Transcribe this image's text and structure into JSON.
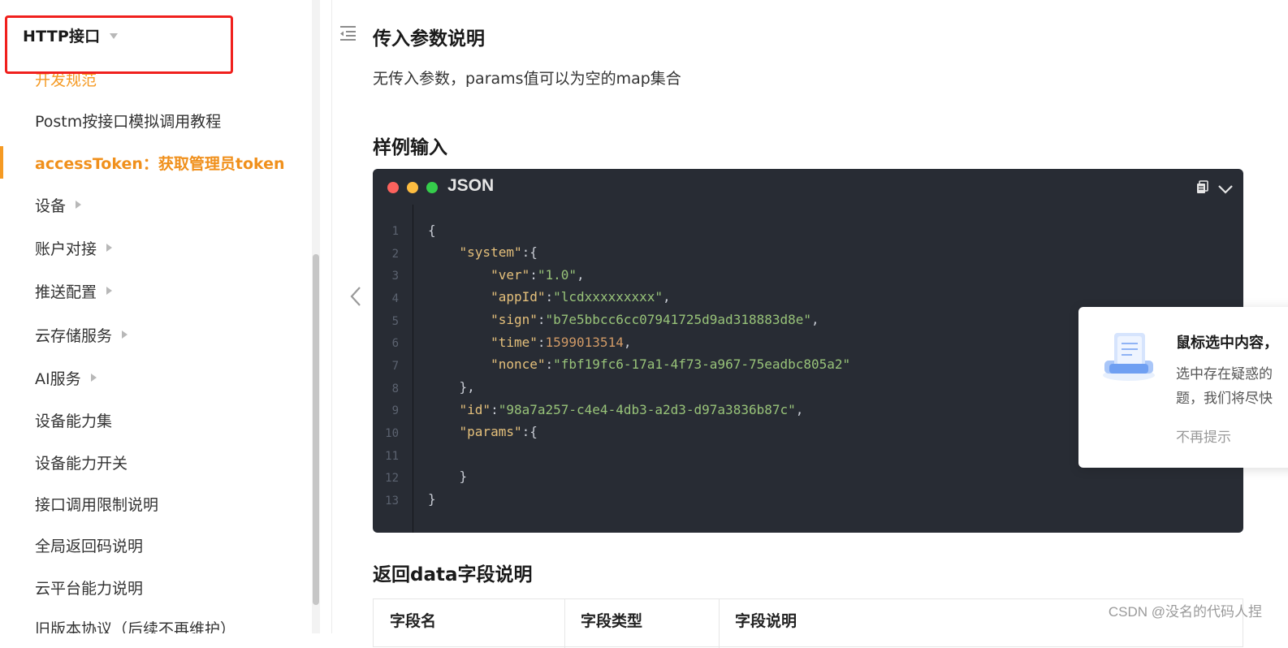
{
  "sidebar": {
    "section_title": "HTTP接口",
    "items": [
      {
        "label": "开发规范"
      },
      {
        "label": "Postm按接口模拟调用教程"
      },
      {
        "label": "accessToken：获取管理员token"
      },
      {
        "label": "设备"
      },
      {
        "label": "账户对接"
      },
      {
        "label": "推送配置"
      },
      {
        "label": "云存储服务"
      },
      {
        "label": "AI服务"
      },
      {
        "label": "设备能力集"
      },
      {
        "label": "设备能力开关"
      },
      {
        "label": "接口调用限制说明"
      },
      {
        "label": "全局返回码说明"
      },
      {
        "label": "云平台能力说明"
      },
      {
        "label": "旧版本协议（后续不再维护）"
      }
    ]
  },
  "main": {
    "params_heading": "传入参数说明",
    "params_text": "无传入参数，params值可以为空的map集合",
    "sample_heading": "样例输入",
    "return_heading": "返回data字段说明"
  },
  "code": {
    "language": "JSON",
    "line_numbers": [
      "1",
      "2",
      "3",
      "4",
      "5",
      "6",
      "7",
      "8",
      "9",
      "10",
      "11",
      "12",
      "13"
    ],
    "keys": {
      "system": "\"system\"",
      "ver": "\"ver\"",
      "appId": "\"appId\"",
      "sign": "\"sign\"",
      "time": "\"time\"",
      "nonce": "\"nonce\"",
      "id": "\"id\"",
      "params": "\"params\""
    },
    "values": {
      "ver": "\"1.0\"",
      "appId": "\"lcdxxxxxxxxx\"",
      "sign": "\"b7e5bbcc6cc07941725d9ad318883d8e\"",
      "time": "1599013514",
      "nonce": "\"fbf19fc6-17a1-4f73-a967-75eadbc805a2\"",
      "id": "\"98a7a257-c4e4-4db3-a2d3-d97a3836b87c\""
    },
    "colors": {
      "key": "#e5c07b",
      "string": "#98c379",
      "number": "#d19a66",
      "background": "#282c34"
    }
  },
  "table": {
    "headers": [
      "字段名",
      "字段类型",
      "字段说明"
    ]
  },
  "tooltip": {
    "title": "鼠标选中内容，",
    "line1": "选中存在疑惑的",
    "line2": "题，我们将尽快",
    "dismiss": "不再提示"
  },
  "watermark": "CSDN @没名的代码人捏",
  "icons": [
    "caret-down-icon",
    "caret-right-icon",
    "toc-icon",
    "chevron-left-icon",
    "copy-icon",
    "chevron-down-icon",
    "document-illustration-icon"
  ],
  "accent_color": "#f59a23",
  "highlight_color": "#f0201d"
}
